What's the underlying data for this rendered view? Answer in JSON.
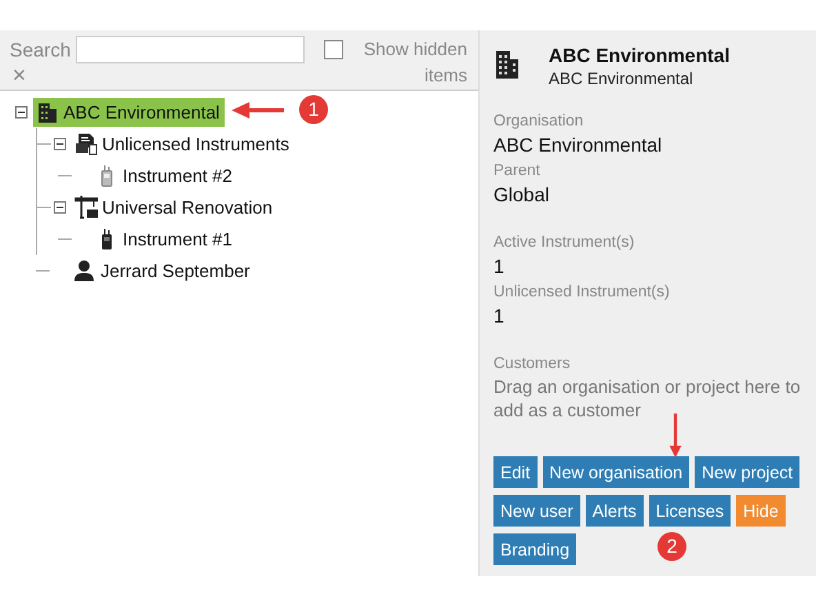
{
  "search": {
    "label": "Search",
    "clear": "×"
  },
  "show_hidden": {
    "label": "Show hidden items",
    "checked": false
  },
  "tree": [
    {
      "label": "ABC Environmental",
      "kind": "organisation",
      "selected": true,
      "expanded": true,
      "children": [
        {
          "label": "Unlicensed Instruments",
          "kind": "unlicensed",
          "selected": false,
          "expanded": true,
          "children": [
            {
              "label": "Instrument #2",
              "kind": "instrument-grey",
              "selected": false
            }
          ]
        },
        {
          "label": "Universal Renovation",
          "kind": "project",
          "selected": false,
          "expanded": true,
          "children": [
            {
              "label": "Instrument #1",
              "kind": "instrument",
              "selected": false
            }
          ]
        },
        {
          "label": "Jerrard September",
          "kind": "user",
          "selected": false
        }
      ]
    }
  ],
  "details": {
    "title": "ABC Environmental",
    "subtitle": "ABC Environmental",
    "fields": [
      {
        "label": "Organisation",
        "value": "ABC Environmental"
      },
      {
        "label": "Parent",
        "value": "Global"
      },
      {
        "label": "Active Instrument(s)",
        "value": "1",
        "gap": true
      },
      {
        "label": "Unlicensed Instrument(s)",
        "value": "1"
      },
      {
        "label": "Customers",
        "value": "Drag an organisation or project here to add as a customer",
        "gap": true,
        "hint": true
      }
    ],
    "buttons": [
      [
        {
          "label": "Edit",
          "color": "#2e7db5"
        },
        {
          "label": "New organisation",
          "color": "#2e7db5"
        },
        {
          "label": "New project",
          "color": "#2e7db5"
        }
      ],
      [
        {
          "label": "New user",
          "color": "#2e7db5"
        },
        {
          "label": "Alerts",
          "color": "#2e7db5"
        },
        {
          "label": "Licenses",
          "color": "#2e7db5"
        },
        {
          "label": "Hide",
          "color": "#f28a30"
        }
      ],
      [
        {
          "label": "Branding",
          "color": "#2e7db5"
        }
      ]
    ]
  },
  "callouts": [
    {
      "number": "1",
      "kind": "left"
    },
    {
      "number": "2",
      "kind": "down"
    }
  ]
}
